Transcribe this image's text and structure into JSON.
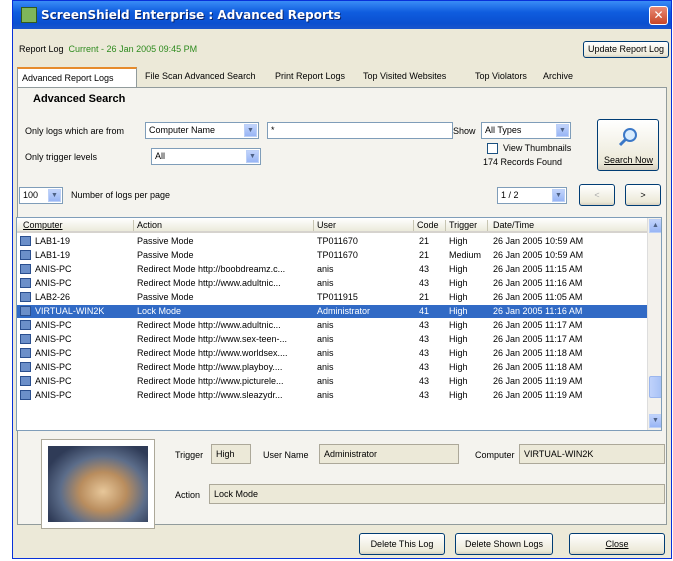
{
  "window": {
    "title": "ScreenShield Enterprise : Advanced Reports",
    "close_glyph": "✕"
  },
  "report_log": {
    "label": "Report Log",
    "current": "Current - 26 Jan 2005 09:45 PM",
    "update_button": "Update Report Log"
  },
  "tabs": [
    {
      "label": "Advanced Report Logs"
    },
    {
      "label": "File Scan Advanced Search"
    },
    {
      "label": "Print Report Logs"
    },
    {
      "label": "Top Visited Websites"
    },
    {
      "label": "Top Violators"
    },
    {
      "label": "Archive"
    }
  ],
  "advanced_search": {
    "title": "Advanced Search",
    "only_logs_label": "Only logs which are from",
    "field_select": "Computer Name",
    "field_value": "*",
    "trigger_label": "Only trigger levels",
    "trigger_select": "All",
    "show_label": "Show",
    "show_select": "All Types",
    "view_thumbnails_label": "View Thumbnails",
    "view_thumbnails_checked": false,
    "records_found": "174 Records Found",
    "search_button": "Search Now",
    "search_icon": "magnifier-icon"
  },
  "paging": {
    "per_page": "100",
    "per_page_label": "Number of logs per page",
    "page": "1 / 2",
    "prev": "<",
    "next": ">"
  },
  "table": {
    "columns": [
      "Computer",
      "Action",
      "User",
      "Code",
      "Trigger",
      "Date/Time"
    ],
    "rows": [
      [
        "LAB1-19",
        "Passive Mode",
        "TP011670",
        "21",
        "High",
        "26 Jan 2005 10:59 AM"
      ],
      [
        "LAB1-19",
        "Passive Mode",
        "TP011670",
        "21",
        "Medium",
        "26 Jan 2005 10:59 AM"
      ],
      [
        "ANIS-PC",
        "Redirect Mode http://boobdreamz.c...",
        "anis",
        "43",
        "High",
        "26 Jan 2005 11:15 AM"
      ],
      [
        "ANIS-PC",
        "Redirect Mode http://www.adultnic...",
        "anis",
        "43",
        "High",
        "26 Jan 2005 11:16 AM"
      ],
      [
        "LAB2-26",
        "Passive Mode",
        "TP011915",
        "21",
        "High",
        "26 Jan 2005 11:05 AM"
      ],
      [
        "VIRTUAL-WIN2K",
        "Lock Mode",
        "Administrator",
        "41",
        "High",
        "26 Jan 2005 11:16 AM"
      ],
      [
        "ANIS-PC",
        "Redirect Mode http://www.adultnic...",
        "anis",
        "43",
        "High",
        "26 Jan 2005 11:17 AM"
      ],
      [
        "ANIS-PC",
        "Redirect Mode http://www.sex-teen-...",
        "anis",
        "43",
        "High",
        "26 Jan 2005 11:17 AM"
      ],
      [
        "ANIS-PC",
        "Redirect Mode http://www.worldsex....",
        "anis",
        "43",
        "High",
        "26 Jan 2005 11:18 AM"
      ],
      [
        "ANIS-PC",
        "Redirect Mode http://www.playboy....",
        "anis",
        "43",
        "High",
        "26 Jan 2005 11:18 AM"
      ],
      [
        "ANIS-PC",
        "Redirect Mode http://www.picturele...",
        "anis",
        "43",
        "High",
        "26 Jan 2005 11:19 AM"
      ],
      [
        "ANIS-PC",
        "Redirect Mode http://www.sleazydr...",
        "anis",
        "43",
        "High",
        "26 Jan 2005 11:19 AM"
      ]
    ],
    "selected_row": 5
  },
  "detail": {
    "trigger_label": "Trigger",
    "trigger_value": "High",
    "user_label": "User Name",
    "user_value": "Administrator",
    "computer_label": "Computer",
    "computer_value": "VIRTUAL-WIN2K",
    "action_label": "Action",
    "action_value": "Lock Mode"
  },
  "buttons": {
    "delete_log": "Delete This Log",
    "delete_shown": "Delete Shown Logs",
    "close": "Close"
  }
}
